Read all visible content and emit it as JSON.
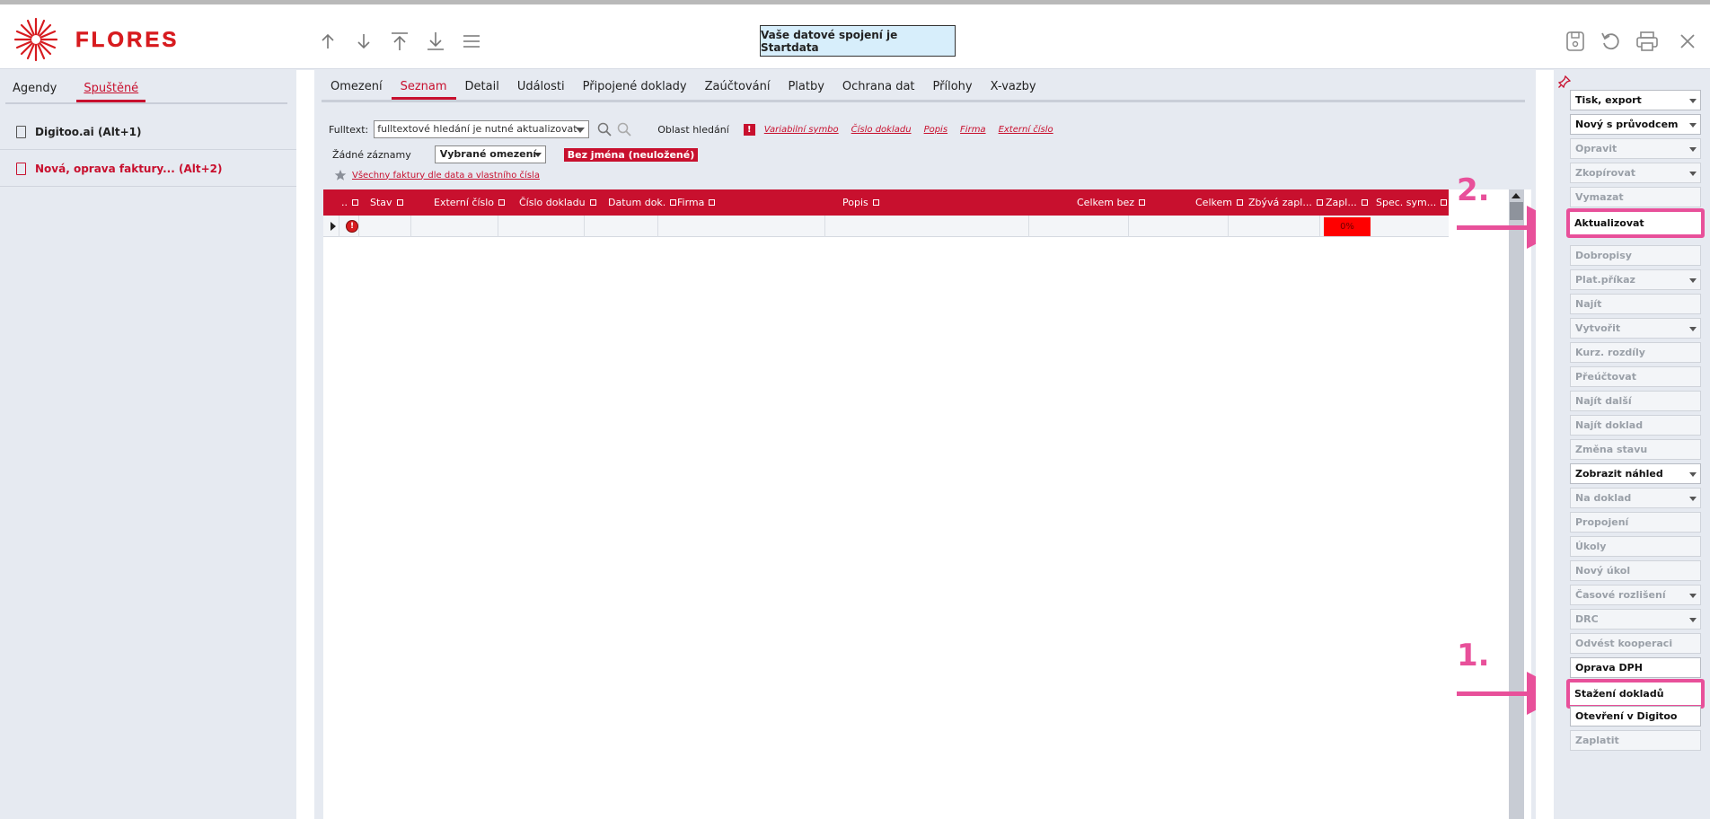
{
  "app": {
    "logo_text": "FLORES"
  },
  "header": {
    "connection_text": "Vaše datové spojení je Startdata",
    "nav_icons": [
      "arrow-up-icon",
      "arrow-down-icon",
      "arrow-to-top-icon",
      "arrow-to-bottom-icon",
      "menu-icon"
    ],
    "right_icons": [
      "save-icon",
      "refresh-icon",
      "print-icon",
      "close-icon"
    ]
  },
  "left": {
    "tabs": [
      "Agendy",
      "Spuštěné"
    ],
    "items": [
      "Digitoo.ai (Alt+1)",
      "Nová, oprava faktury... (Alt+2)"
    ]
  },
  "main": {
    "tabs": [
      "Omezení",
      "Seznam",
      "Detail",
      "Události",
      "Připojené doklady",
      "Zaúčtování",
      "Platby",
      "Ochrana dat",
      "Přílohy",
      "X-vazby"
    ],
    "fulltext_label": "Fulltext:",
    "fulltext_value": "fulltextové hledání je nutné aktualizovat",
    "oblast_label": "Oblast hledání",
    "search_links": [
      "Variabilní symbo",
      "Číslo dokladu",
      "Popis",
      "Firma",
      "Externí číslo"
    ],
    "records_label": "Žádné záznamy",
    "filter_value": "Vybrané omezení",
    "unsaved_badge": "Bez jména (neuložené)",
    "favorite_link": "Všechny faktury dle data a vlastního čísla"
  },
  "grid": {
    "columns": [
      "..",
      "Stav",
      "Externí číslo",
      "Číslo dokladu",
      "Datum dok.",
      "Firma",
      "Popis",
      "Celkem bez",
      "Celkem",
      "Zbývá zapl...",
      "Zapl...",
      "Spec. sym..."
    ],
    "row_paid_percent": "0%"
  },
  "annotations": {
    "step1": "1.",
    "step2": "2."
  },
  "right": {
    "buttons": [
      {
        "label": "Tisk, export",
        "dropdown": true,
        "enabled": true
      },
      {
        "label": "Nový s průvodcem",
        "dropdown": true,
        "enabled": true
      },
      {
        "label": "Opravit",
        "dropdown": true,
        "enabled": false
      },
      {
        "label": "Zkopírovat",
        "dropdown": true,
        "enabled": false
      },
      {
        "label": "Vymazat",
        "dropdown": false,
        "enabled": false
      },
      {
        "label": "Aktualizovat",
        "dropdown": false,
        "enabled": true
      },
      {
        "label": "Dobropisy",
        "dropdown": false,
        "enabled": false
      },
      {
        "label": "Plat.příkaz",
        "dropdown": true,
        "enabled": false
      },
      {
        "label": "Najít",
        "dropdown": false,
        "enabled": false
      },
      {
        "label": "Vytvořit",
        "dropdown": true,
        "enabled": false
      },
      {
        "label": "Kurz. rozdíly",
        "dropdown": false,
        "enabled": false
      },
      {
        "label": "Přeúčtovat",
        "dropdown": false,
        "enabled": false
      },
      {
        "label": "Najít další",
        "dropdown": false,
        "enabled": false
      },
      {
        "label": "Najít doklad",
        "dropdown": false,
        "enabled": false
      },
      {
        "label": "Změna stavu",
        "dropdown": false,
        "enabled": false
      },
      {
        "label": "Zobrazit náhled",
        "dropdown": true,
        "enabled": true
      },
      {
        "label": "Na doklad",
        "dropdown": true,
        "enabled": false
      },
      {
        "label": "Propojení",
        "dropdown": false,
        "enabled": false
      },
      {
        "label": "Úkoly",
        "dropdown": false,
        "enabled": false
      },
      {
        "label": "Nový úkol",
        "dropdown": false,
        "enabled": false
      },
      {
        "label": "Časové rozlišení",
        "dropdown": true,
        "enabled": false
      },
      {
        "label": "DRC",
        "dropdown": true,
        "enabled": false
      },
      {
        "label": "Odvést kooperaci",
        "dropdown": false,
        "enabled": false
      },
      {
        "label": "Oprava DPH",
        "dropdown": false,
        "enabled": true
      },
      {
        "label": "Stažení dokladů",
        "dropdown": false,
        "enabled": true
      },
      {
        "label": "Otevření v Digitoo",
        "dropdown": false,
        "enabled": true
      },
      {
        "label": "Zaplatit",
        "dropdown": false,
        "enabled": false
      }
    ]
  },
  "colors": {
    "brand_red": "#c8102e",
    "annotation_pink": "#e8509a",
    "panel_bg": "#e6eaf1"
  }
}
